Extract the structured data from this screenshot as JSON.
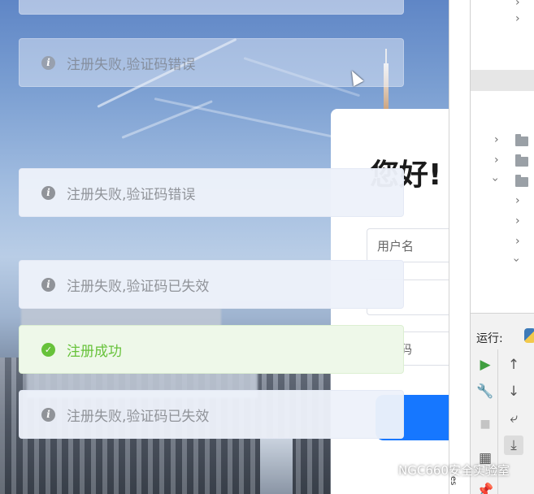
{
  "login": {
    "greeting": "您好!",
    "username_placeholder": "用户名",
    "password_fragment": "码"
  },
  "toasts": [
    {
      "type": "info",
      "icon": "info-icon",
      "message": ""
    },
    {
      "type": "info",
      "icon": "info-icon",
      "message": "注册失败,验证码错误"
    },
    {
      "type": "info",
      "icon": "info-icon",
      "message": "注册失败,验证码错误"
    },
    {
      "type": "info",
      "icon": "info-icon",
      "message": "注册失败,验证码已失效"
    },
    {
      "type": "success",
      "icon": "check-circle-icon",
      "message": "注册成功"
    },
    {
      "type": "info",
      "icon": "info-icon",
      "message": "注册失败,验证码已失效"
    }
  ],
  "ide": {
    "run_label": "运行:",
    "side_text": "es"
  },
  "watermark": {
    "text": "NGC660安全实验室",
    "icon": "wechat-icon"
  },
  "colors": {
    "info_text": "#909399",
    "success": "#67c23a",
    "primary": "#1677ff"
  }
}
